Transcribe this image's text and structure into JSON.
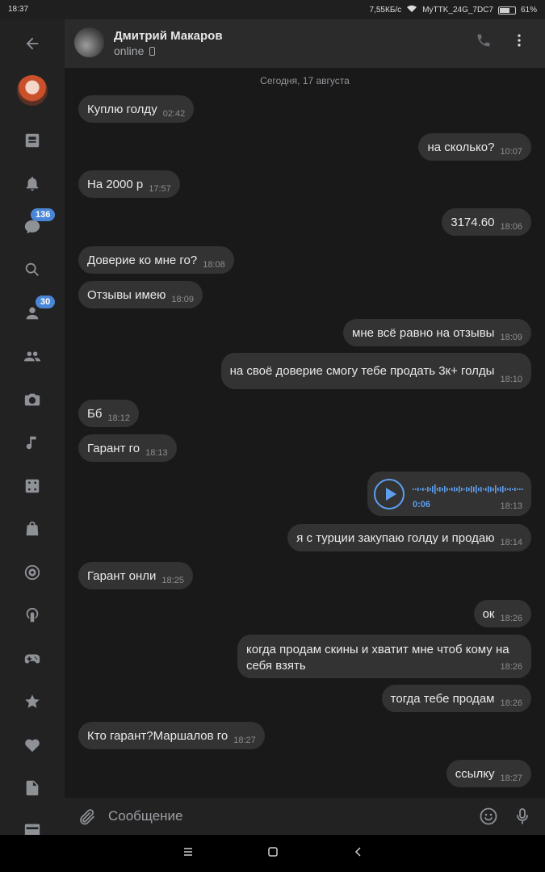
{
  "status_bar": {
    "time": "18:37",
    "speed": "7,55КБ/с",
    "network": "MyTTK_24G_7DC7",
    "battery": "61%"
  },
  "sidebar": {
    "badges": {
      "messages": "136",
      "friends": "30"
    }
  },
  "header": {
    "name": "Дмитрий Макаров",
    "status": "online"
  },
  "chat": {
    "date_label": "Сегодня, 17 августа",
    "messages": [
      {
        "text": "Куплю голду",
        "time": "02:42"
      },
      {
        "text": "на сколько?",
        "time": "10:07"
      },
      {
        "text": "На 2000 р",
        "time": "17:57"
      },
      {
        "text": "3174.60",
        "time": "18:06"
      },
      {
        "text": "Доверие ко мне го?",
        "time": "18:08"
      },
      {
        "text": "Отзывы имею",
        "time": "18:09"
      },
      {
        "text": "мне всё равно на отзывы",
        "time": "18:09"
      },
      {
        "text": "на своё доверие смогу тебе продать 3к+ голды",
        "time": "18:10"
      },
      {
        "text": "Бб",
        "time": "18:12"
      },
      {
        "text": "Гарант го",
        "time": "18:13"
      },
      {
        "text": "я с турции закупаю голду и продаю",
        "time": "18:14"
      },
      {
        "text": "Гарант онли",
        "time": "18:25"
      },
      {
        "text": "ок",
        "time": "18:26"
      },
      {
        "text": "когда продам скины и хватит мне чтоб кому на себя взять",
        "time": "18:26"
      },
      {
        "text": "тогда тебе продам",
        "time": "18:26"
      },
      {
        "text": "Кто гарант?Маршалов го",
        "time": "18:27"
      },
      {
        "text": "ссылку",
        "time": "18:27"
      }
    ],
    "voice": {
      "duration": "0:06",
      "time": "18:13"
    }
  },
  "composer": {
    "placeholder": "Сообщение"
  },
  "colors": {
    "accent": "#5d9ef0",
    "bubble": "#333333",
    "badge": "#4a86d6"
  }
}
